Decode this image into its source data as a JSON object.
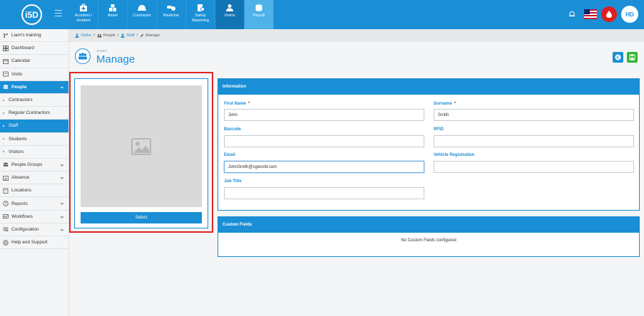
{
  "app": {
    "logo_text": "i5D"
  },
  "modules": [
    {
      "label": "Accident / Incident",
      "icon": "medical-kit-icon"
    },
    {
      "label": "Asset",
      "icon": "asset-boxes-icon"
    },
    {
      "label": "Contractor",
      "icon": "hard-hat-icon"
    },
    {
      "label": "Medicine",
      "icon": "pills-icon"
    },
    {
      "label": "Safety Reporting",
      "icon": "safety-report-icon"
    },
    {
      "label": "Visitor",
      "icon": "person-icon",
      "active": true
    },
    {
      "label": "Payroll",
      "icon": "coins-icon"
    }
  ],
  "user": {
    "initials": "HD"
  },
  "sidebar": {
    "items": [
      {
        "label": "Liam's training",
        "icon": "branch-icon"
      },
      {
        "label": "Dashboard",
        "icon": "dashboard-icon"
      },
      {
        "label": "Calendar",
        "icon": "calendar-icon"
      },
      {
        "label": "Visits",
        "icon": "visits-icon"
      },
      {
        "label": "People",
        "icon": "people-icon",
        "active": true
      },
      {
        "label": "Contractors",
        "sub": true
      },
      {
        "label": "Regular Contractors",
        "sub": true
      },
      {
        "label": "Staff",
        "sub": true,
        "active": true
      },
      {
        "label": "Students",
        "sub": true
      },
      {
        "label": "Visitors",
        "sub": true
      },
      {
        "label": "People Groups",
        "icon": "people-groups-icon"
      },
      {
        "label": "Absence",
        "icon": "absence-icon"
      },
      {
        "label": "Locations",
        "icon": "locations-icon"
      },
      {
        "label": "Reports",
        "icon": "reports-icon"
      },
      {
        "label": "Workflows",
        "icon": "workflows-icon"
      },
      {
        "label": "Configuration",
        "icon": "configuration-icon"
      },
      {
        "label": "Help and Support",
        "icon": "help-icon"
      }
    ]
  },
  "breadcrumb": [
    "Visitor",
    "People",
    "Staff",
    "Manage"
  ],
  "page": {
    "super": "STAFF",
    "title": "Manage"
  },
  "photo": {
    "select_label": "Select"
  },
  "info": {
    "heading": "Information",
    "first_name_label": "First Name",
    "first_name_value": "John",
    "surname_label": "Surname",
    "surname_value": "Smith",
    "barcode_label": "Barcode",
    "barcode_value": "",
    "rfid_label": "RFID",
    "rfid_value": "",
    "email_label": "Email",
    "email_value": "JohnSmith@sgworld.com",
    "vehicle_label": "Vehicle Registration",
    "vehicle_value": "",
    "job_title_label": "Job Title",
    "job_title_value": "",
    "required_mark": "*"
  },
  "custom_fields": {
    "heading": "Custom Fields",
    "empty_message": "No Custom Fields configured"
  },
  "colors": {
    "primary": "#1a8fd6",
    "alert": "#e02424",
    "save": "#2fb52f"
  }
}
